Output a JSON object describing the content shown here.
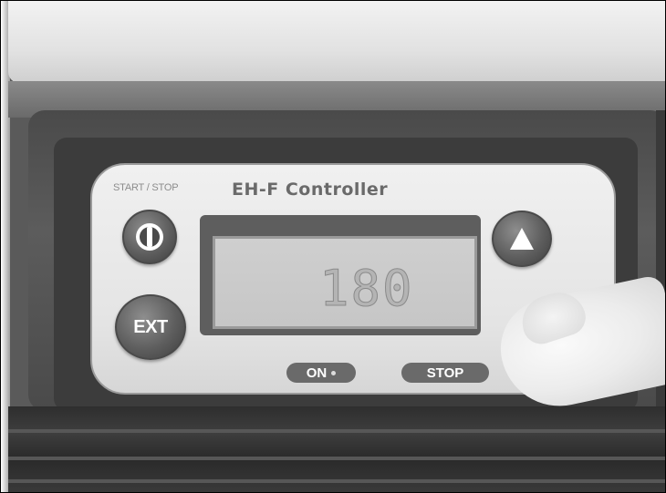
{
  "controller": {
    "start_stop_label": "START / STOP",
    "title": "EH-F Controller",
    "ext_label": "EXT",
    "lcd_value": "180",
    "indicator_on_label": "ON",
    "indicator_stop_label": "STOP"
  },
  "icons": {
    "power": "power-icon",
    "up": "up-arrow-icon"
  },
  "colors": {
    "faceplate": "#e6e6e6",
    "button": "#5e5e5e",
    "lcd": "#c8c8c8"
  }
}
